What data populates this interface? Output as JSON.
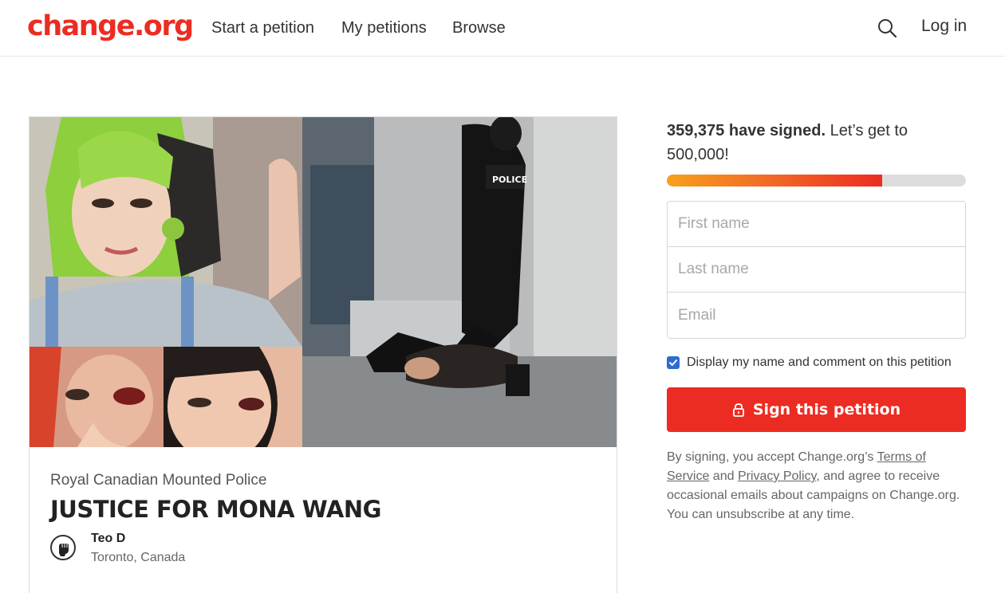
{
  "brand": {
    "logo_text": "change.org",
    "logo_color": "#ec2c22"
  },
  "nav": {
    "start_petition": "Start a petition",
    "my_petitions": "My petitions",
    "browse": "Browse",
    "search_icon": "search-icon",
    "login": "Log in"
  },
  "petition": {
    "target": "Royal Canadian Mounted Police",
    "title": "JUSTICE FOR MONA WANG",
    "author_name": "Teo D",
    "author_location": "Toronto, Canada",
    "police_label": "POLICE"
  },
  "signing": {
    "signed_count": "359,375 have signed.",
    "goal_text": " Let’s get to 500,000!",
    "progress_fraction": 0.72,
    "first_name_placeholder": "First name",
    "last_name_placeholder": "Last name",
    "email_placeholder": "Email",
    "consent_checked": true,
    "consent_label": "Display my name and comment on this petition",
    "sign_button": "Sign this petition",
    "legal_1": "By signing, you accept Change.org’s ",
    "terms_link": "Terms of Service",
    "legal_2": " and ",
    "privacy_link": "Privacy Policy",
    "legal_3": ", and agree to receive occasional emails about campaigns on Change.org. You can unsubscribe at any time."
  },
  "colors": {
    "accent_red": "#ec2c22",
    "checkbox_blue": "#2f6bd0",
    "progress_start": "#f8a01c",
    "progress_end": "#ec2c22"
  }
}
